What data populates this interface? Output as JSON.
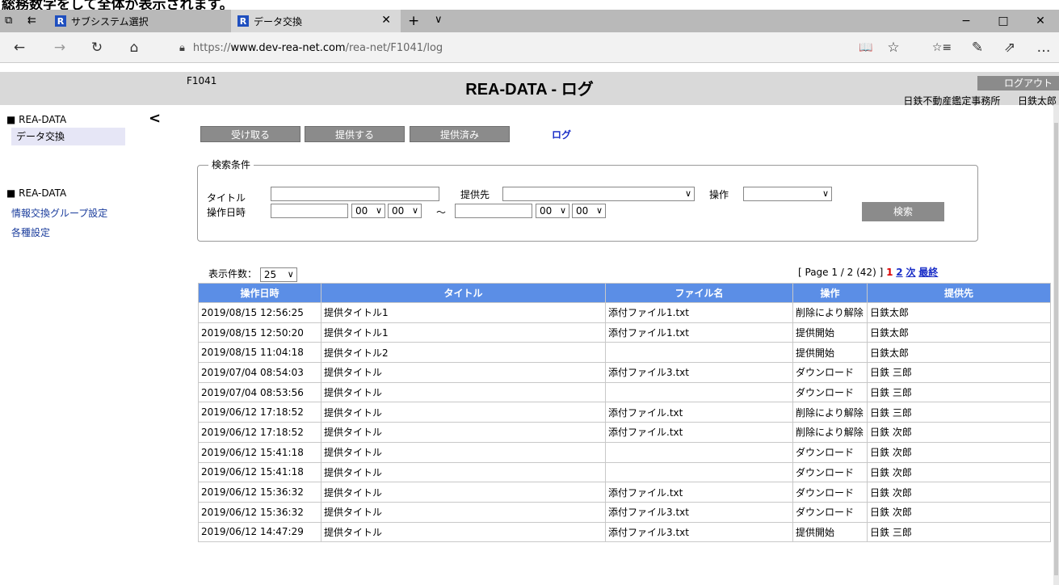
{
  "window": {
    "caption_fragment": "総務数字をして全体が表示されます。",
    "tabs": [
      {
        "label": "サブシステム選択"
      },
      {
        "label": "データ交換"
      }
    ],
    "new_tab": "+",
    "tab_list": "∨",
    "controls": {
      "minimize": "−",
      "maximize": "□",
      "close": "✕"
    }
  },
  "browser": {
    "back": "←",
    "forward": "→",
    "refresh": "↻",
    "home": "⌂",
    "url_prefix": "https://",
    "url_host": "www.dev-rea-net.com",
    "url_path": "/rea-net/F1041/log",
    "reading_view": "📖",
    "favorite": "☆",
    "favorites": "☆≡",
    "notes": "✎",
    "share": "⇗",
    "more": "…"
  },
  "header": {
    "page_code": "F1041",
    "title": "REA-DATA - ログ",
    "logout": "ログアウト",
    "office": "日鉄不動産鑑定事務所",
    "user": "日鉄太郎"
  },
  "sidebar": {
    "collapse": "<",
    "section1_title": "■ REA-DATA",
    "section1_items": [
      "データ交換"
    ],
    "section2_title": "■ REA-DATA",
    "section2_items": [
      "情報交換グループ設定",
      "各種設定"
    ]
  },
  "tabs": {
    "receive": "受け取る",
    "provide": "提供する",
    "provided": "提供済み",
    "log": "ログ"
  },
  "search": {
    "legend": "検索条件",
    "title_label": "タイトル",
    "title_value": "",
    "target_label": "提供先",
    "target_value": "",
    "operation_label": "操作",
    "operation_value": "",
    "datetime_label": "操作日時",
    "from_date": "",
    "from_hour": "00",
    "from_min": "00",
    "tilde": "～",
    "to_date": "",
    "to_hour": "00",
    "to_min": "00",
    "button": "検索"
  },
  "list": {
    "perpage_label": "表示件数：",
    "perpage_value": "25",
    "pager_text": "[ Page 1 / 2 (42) ]",
    "page1": "1",
    "page2": "2",
    "next": "次",
    "last": "最終",
    "columns": [
      "操作日時",
      "タイトル",
      "ファイル名",
      "操作",
      "提供先"
    ],
    "rows": [
      [
        "2019/08/15 12:56:25",
        "提供タイトル1",
        "添付ファイル1.txt",
        "削除により解除",
        "日鉄太郎"
      ],
      [
        "2019/08/15 12:50:20",
        "提供タイトル1",
        "添付ファイル1.txt",
        "提供開始",
        "日鉄太郎"
      ],
      [
        "2019/08/15 11:04:18",
        "提供タイトル2",
        "",
        "提供開始",
        "日鉄太郎"
      ],
      [
        "2019/07/04 08:54:03",
        "提供タイトル",
        "添付ファイル3.txt",
        "ダウンロード",
        "日鉄 三郎"
      ],
      [
        "2019/07/04 08:53:56",
        "提供タイトル",
        "",
        "ダウンロード",
        "日鉄 三郎"
      ],
      [
        "2019/06/12 17:18:52",
        "提供タイトル",
        "添付ファイル.txt",
        "削除により解除",
        "日鉄 三郎"
      ],
      [
        "2019/06/12 17:18:52",
        "提供タイトル",
        "添付ファイル.txt",
        "削除により解除",
        "日鉄 次郎"
      ],
      [
        "2019/06/12 15:41:18",
        "提供タイトル",
        "",
        "ダウンロード",
        "日鉄 次郎"
      ],
      [
        "2019/06/12 15:41:18",
        "提供タイトル",
        "",
        "ダウンロード",
        "日鉄 次郎"
      ],
      [
        "2019/06/12 15:36:32",
        "提供タイトル",
        "添付ファイル.txt",
        "ダウンロード",
        "日鉄 次郎"
      ],
      [
        "2019/06/12 15:36:32",
        "提供タイトル",
        "添付ファイル3.txt",
        "ダウンロード",
        "日鉄 次郎"
      ],
      [
        "2019/06/12 14:47:29",
        "提供タイトル",
        "添付ファイル3.txt",
        "提供開始",
        "日鉄 三郎"
      ]
    ]
  }
}
